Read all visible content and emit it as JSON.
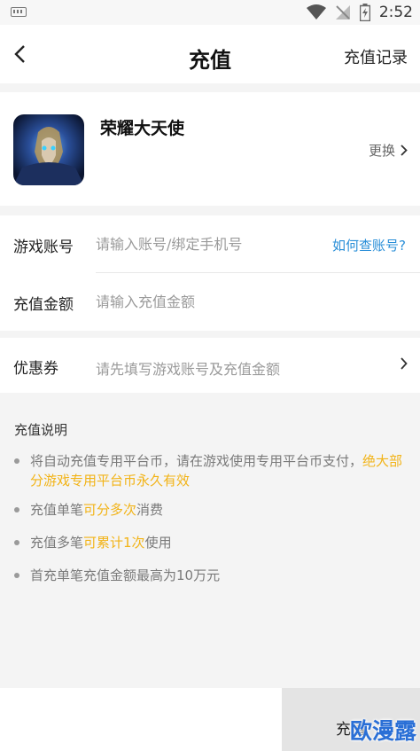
{
  "status_bar": {
    "time": "2:52"
  },
  "nav": {
    "title": "充值",
    "right_action": "充值记录"
  },
  "game": {
    "name": "荣耀大天使",
    "switch_label": "更换"
  },
  "form": {
    "account_label": "游戏账号",
    "account_placeholder": "请输入账号/绑定手机号",
    "account_help": "如何查账号?",
    "amount_label": "充值金额",
    "amount_placeholder": "请输入充值金额"
  },
  "coupon": {
    "label": "优惠券",
    "hint": "请先填写游戏账号及充值金额"
  },
  "notes": {
    "title": "充值说明",
    "n1_text": "将自动充值专用平台币，请在游戏使用专用平台币支付，",
    "n1_hl": "绝大部分游戏专用平台币永久有效",
    "n2_pre": "充值单笔",
    "n2_hl": "可分多次",
    "n2_post": "消费",
    "n3_pre": "充值多笔",
    "n3_hl": "可累计1次",
    "n3_post": "使用",
    "n4_text": "首充单笔充值金额最高为10万元"
  },
  "bottom": {
    "pay_label": "充值",
    "watermark": "欧漫露"
  },
  "colors": {
    "accent_link": "#2a8fd8",
    "highlight": "#f2b316"
  },
  "icons": [
    "keyboard-icon",
    "wifi-icon",
    "signal-off-icon",
    "battery-icon",
    "back-arrow-icon",
    "chevron-right-icon"
  ]
}
